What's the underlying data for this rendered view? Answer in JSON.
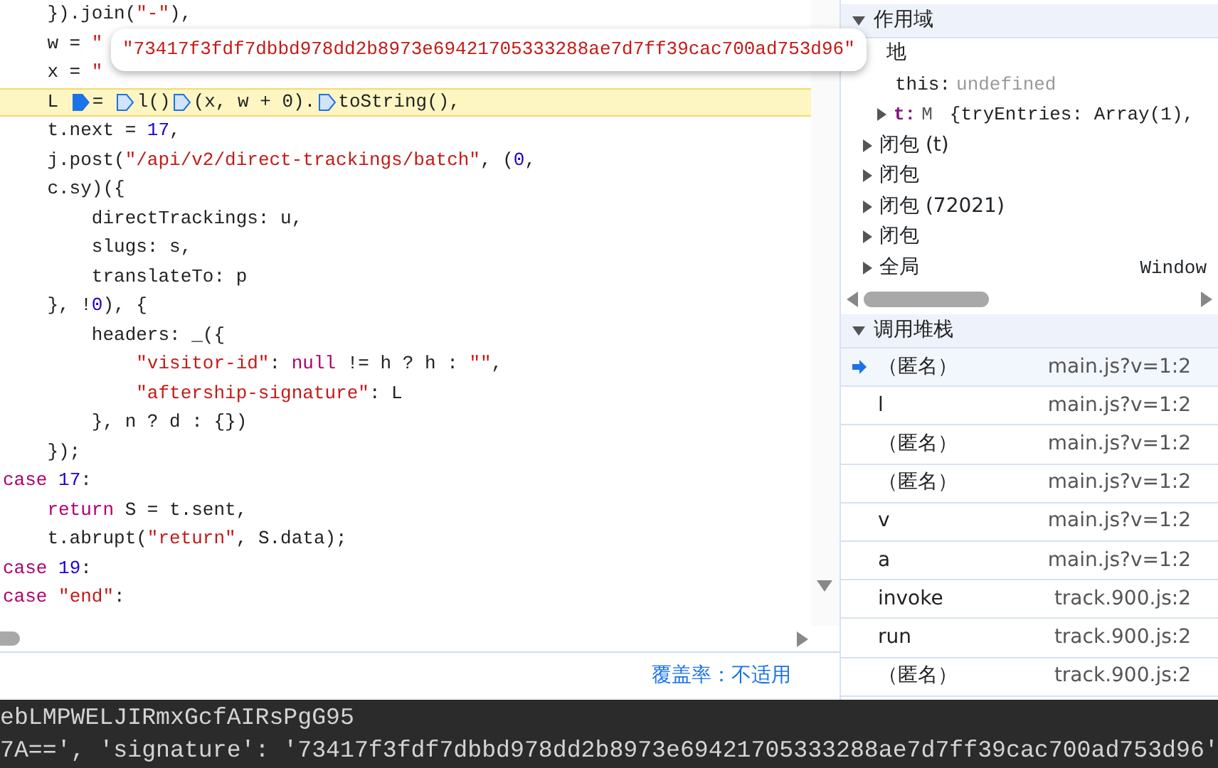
{
  "code": {
    "lines": [
      {
        "highlighted": false,
        "tokens": [
          {
            "kind": "plain",
            "text": "    }).join("
          },
          {
            "kind": "string",
            "text": "\"-\""
          },
          {
            "kind": "plain",
            "text": "),"
          }
        ]
      },
      {
        "highlighted": false,
        "tokens": [
          {
            "kind": "plain",
            "text": "    w = "
          },
          {
            "kind": "string",
            "text": "\""
          }
        ]
      },
      {
        "highlighted": false,
        "tokens": [
          {
            "kind": "plain",
            "text": "    x = "
          },
          {
            "kind": "string",
            "text": "\""
          }
        ]
      },
      {
        "highlighted": true,
        "tokens": [
          {
            "kind": "plain",
            "text": "    L "
          },
          {
            "kind": "marker",
            "active": true
          },
          {
            "kind": "plain",
            "text": "= "
          },
          {
            "kind": "marker",
            "active": false
          },
          {
            "kind": "plain",
            "text": "l()"
          },
          {
            "kind": "marker",
            "active": false
          },
          {
            "kind": "plain",
            "text": "(x, w + 0)."
          },
          {
            "kind": "marker",
            "active": false
          },
          {
            "kind": "plain",
            "text": "toString(),"
          }
        ]
      },
      {
        "highlighted": false,
        "tokens": [
          {
            "kind": "plain",
            "text": "    t.next = "
          },
          {
            "kind": "number",
            "text": "17"
          },
          {
            "kind": "plain",
            "text": ","
          }
        ]
      },
      {
        "highlighted": false,
        "tokens": [
          {
            "kind": "plain",
            "text": "    j.post("
          },
          {
            "kind": "string",
            "text": "\"/api/v2/direct-trackings/batch\""
          },
          {
            "kind": "plain",
            "text": ", ("
          },
          {
            "kind": "number",
            "text": "0"
          },
          {
            "kind": "plain",
            "text": ","
          }
        ]
      },
      {
        "highlighted": false,
        "tokens": [
          {
            "kind": "plain",
            "text": "    c.sy)({"
          }
        ]
      },
      {
        "highlighted": false,
        "tokens": [
          {
            "kind": "plain",
            "text": "        directTrackings: u,"
          }
        ]
      },
      {
        "highlighted": false,
        "tokens": [
          {
            "kind": "plain",
            "text": "        slugs: s,"
          }
        ]
      },
      {
        "highlighted": false,
        "tokens": [
          {
            "kind": "plain",
            "text": "        translateTo: p"
          }
        ]
      },
      {
        "highlighted": false,
        "tokens": [
          {
            "kind": "plain",
            "text": "    }, !"
          },
          {
            "kind": "number",
            "text": "0"
          },
          {
            "kind": "plain",
            "text": "), {"
          }
        ]
      },
      {
        "highlighted": false,
        "tokens": [
          {
            "kind": "plain",
            "text": "        headers: _({"
          }
        ]
      },
      {
        "highlighted": false,
        "tokens": [
          {
            "kind": "string",
            "text": "            \"visitor-id\""
          },
          {
            "kind": "plain",
            "text": ": "
          },
          {
            "kind": "keyword",
            "text": "null"
          },
          {
            "kind": "plain",
            "text": " != h ? h : "
          },
          {
            "kind": "string",
            "text": "\"\""
          },
          {
            "kind": "plain",
            "text": ","
          }
        ]
      },
      {
        "highlighted": false,
        "tokens": [
          {
            "kind": "string",
            "text": "            \"aftership-signature\""
          },
          {
            "kind": "plain",
            "text": ": L"
          }
        ]
      },
      {
        "highlighted": false,
        "tokens": [
          {
            "kind": "plain",
            "text": "        }, n ? d : {})"
          }
        ]
      },
      {
        "highlighted": false,
        "tokens": [
          {
            "kind": "plain",
            "text": "    });"
          }
        ]
      },
      {
        "highlighted": false,
        "tokens": [
          {
            "kind": "keyword",
            "text": "case"
          },
          {
            "kind": "number",
            "text": " 17"
          },
          {
            "kind": "plain",
            "text": ":"
          }
        ]
      },
      {
        "highlighted": false,
        "tokens": [
          {
            "kind": "keyword",
            "text": "    return"
          },
          {
            "kind": "plain",
            "text": " S = t.sent,"
          }
        ]
      },
      {
        "highlighted": false,
        "tokens": [
          {
            "kind": "plain",
            "text": "    t.abrupt("
          },
          {
            "kind": "string",
            "text": "\"return\""
          },
          {
            "kind": "plain",
            "text": ", S.data);"
          }
        ]
      },
      {
        "highlighted": false,
        "tokens": [
          {
            "kind": "keyword",
            "text": "case"
          },
          {
            "kind": "number",
            "text": " 19"
          },
          {
            "kind": "plain",
            "text": ":"
          }
        ]
      },
      {
        "highlighted": false,
        "tokens": [
          {
            "kind": "keyword",
            "text": "case"
          },
          {
            "kind": "string",
            "text": " \"end\""
          },
          {
            "kind": "plain",
            "text": ":"
          }
        ]
      }
    ],
    "tooltip": "\"73417f3fdf7dbbd978dd2b8973e69421705333288ae7d7ff39cac700ad753d96\"",
    "coverage": "覆盖率：不适用"
  },
  "scope": {
    "title": "作用域",
    "expanded": true,
    "items": [
      {
        "label": "地",
        "children": [
          {
            "kind": "value",
            "key": "this:",
            "value": "undefined"
          },
          {
            "kind": "object",
            "key": "t:",
            "class": "M",
            "value": "{tryEntries: Array(1),",
            "expanded": false
          }
        ]
      },
      {
        "label": "闭包 (t)",
        "expanded": false
      },
      {
        "label": "闭包",
        "expanded": false
      },
      {
        "label": "闭包 (72021)",
        "expanded": false
      },
      {
        "label": "闭包",
        "expanded": false
      },
      {
        "label": "全局",
        "expanded": false,
        "value": "Window"
      }
    ]
  },
  "call_stack": {
    "title": "调用堆栈",
    "expanded": true,
    "frames": [
      {
        "name": "（匿名）",
        "location": "main.js?v=1:2",
        "selected": true
      },
      {
        "name": "l",
        "location": "main.js?v=1:2",
        "selected": false
      },
      {
        "name": "（匿名）",
        "location": "main.js?v=1:2",
        "selected": false
      },
      {
        "name": "（匿名）",
        "location": "main.js?v=1:2",
        "selected": false
      },
      {
        "name": "v",
        "location": "main.js?v=1:2",
        "selected": false
      },
      {
        "name": "a",
        "location": "main.js?v=1:2",
        "selected": false
      },
      {
        "name": "invoke",
        "location": "track.900.js:2",
        "selected": false
      },
      {
        "name": "run",
        "location": "track.900.js:2",
        "selected": false
      },
      {
        "name": "（匿名）",
        "location": "track.900.js:2",
        "selected": false
      }
    ]
  },
  "console": {
    "lines": [
      "ebLMPWELJIRmxGcfAIRsPgG95",
      "7A==', 'signature': '73417f3fdf7dbbd978dd2b8973e69421705333288ae7d7ff39cac700ad753d96'"
    ]
  }
}
